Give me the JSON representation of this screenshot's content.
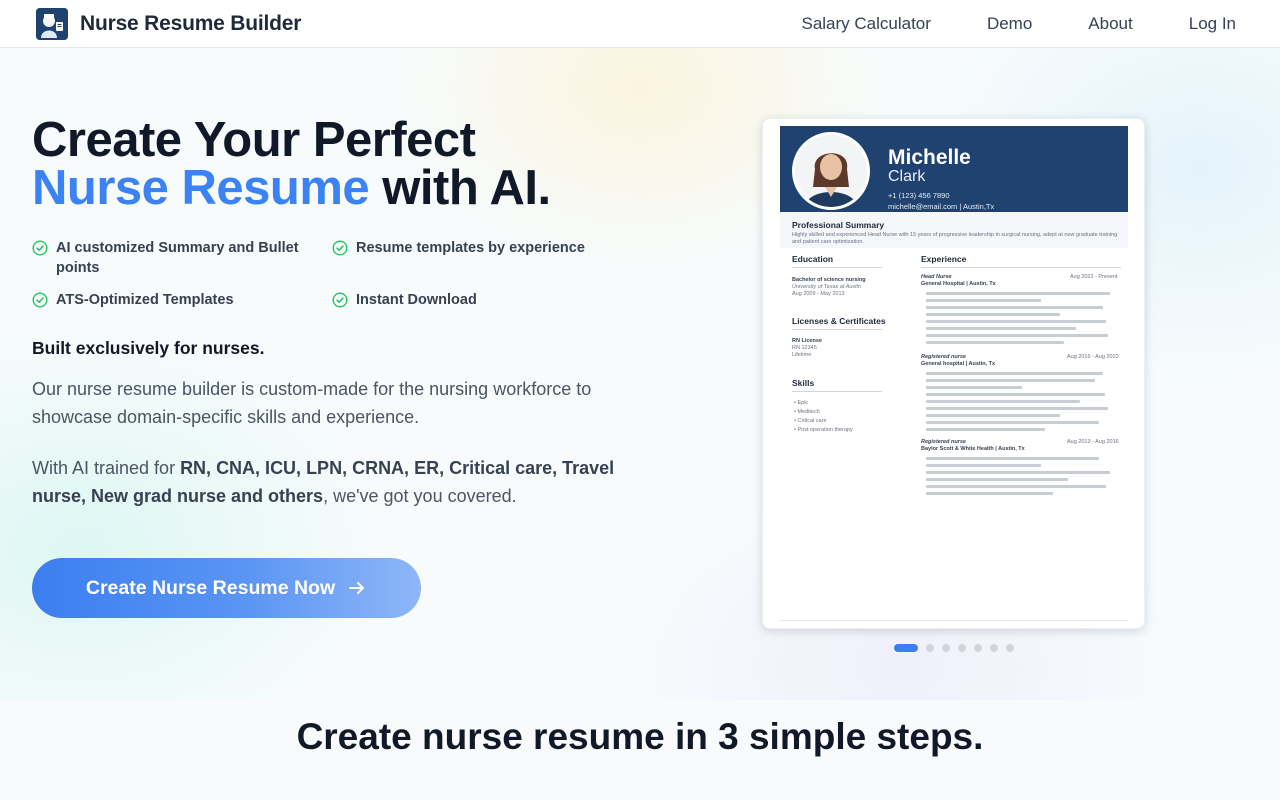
{
  "header": {
    "brand": "Nurse Resume Builder",
    "nav": [
      "Salary Calculator",
      "Demo",
      "About",
      "Log In"
    ]
  },
  "hero": {
    "title_line1": "Create Your Perfect",
    "title_accent": "Nurse Resume",
    "title_rest": " with AI.",
    "features": [
      "AI customized Summary and Bullet points",
      "Resume templates by experience",
      "ATS-Optimized Templates",
      "Instant Download"
    ],
    "subhead": "Built exclusively for nurses.",
    "para1": "Our nurse resume builder is custom-made for the nursing workforce to showcase domain-specific skills and experience.",
    "para2_prefix": "With AI trained for ",
    "para2_bold": "RN, CNA, ICU, LPN, CRNA, ER, Critical care, Travel nurse, New grad nurse and others",
    "para2_suffix": ", we've got you covered.",
    "cta": "Create Nurse Resume Now",
    "accent_color": "#3b82f6"
  },
  "resume": {
    "first_name": "Michelle",
    "last_name": "Clark",
    "phone": "+1 (123) 456 7890",
    "contact": "michelle@email.com  |  Austin,Tx",
    "summary_heading": "Professional Summary",
    "summary_text": "Highly skilled and experienced Head Nurse with 15 years of progressive leadership in surgical nursing, adept at new graduate training and patient care optimization.",
    "education_heading": "Education",
    "degree": "Bachelor of science nursing",
    "school": "University of Texas at Austin",
    "edu_dates": "Aug 2009 - May 2013",
    "licenses_heading": "Licenses & Certificates",
    "license": "RN License",
    "license_no": "RN 12345",
    "license_term": "Lifetime",
    "skills_heading": "Skills",
    "skills": [
      "Epic",
      "Meditech",
      "Critical care",
      "Post operation therapy"
    ],
    "experience_heading": "Experience",
    "jobs": [
      {
        "role": "Head Nurse",
        "place": "General Hospital  |  Austin, Tx",
        "dates": "Aug 2022 - Present"
      },
      {
        "role": "Registered nurse",
        "place": "General hospital  |  Austin, Tx",
        "dates": "Aug 2016 - Aug 2022"
      },
      {
        "role": "Registered nurse",
        "place": "Baylor Scott & White Health  |  Austin, Tx",
        "dates": "Aug 2013 - Aug 2016"
      }
    ]
  },
  "carousel": {
    "count": 7,
    "active": 1
  },
  "steps": {
    "title": "Create nurse resume in 3 simple steps."
  }
}
